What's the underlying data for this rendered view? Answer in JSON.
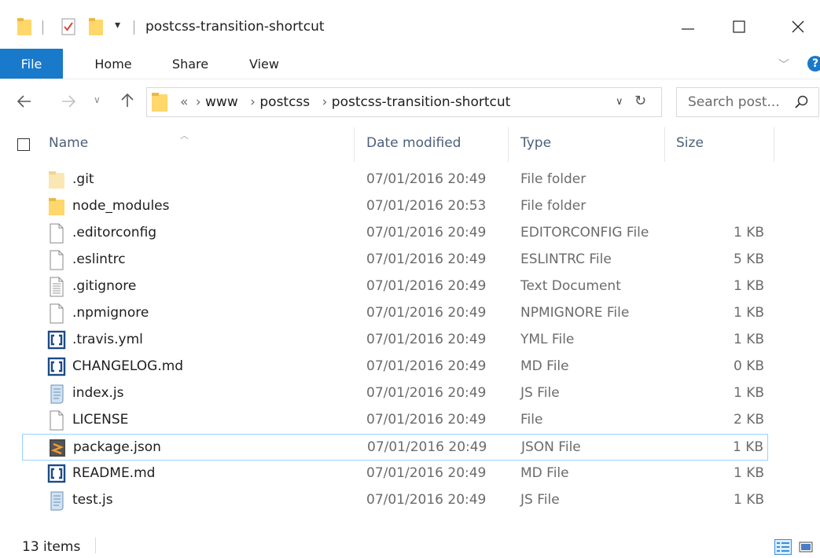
{
  "window": {
    "title": "postcss-transition-shortcut",
    "controls": {
      "minimize": "—",
      "maximize": "☐",
      "close": "✕"
    }
  },
  "ribbon": {
    "tabs": [
      {
        "label": "File",
        "active": true
      },
      {
        "label": "Home"
      },
      {
        "label": "Share"
      },
      {
        "label": "View"
      }
    ],
    "help": "?"
  },
  "nav": {
    "breadcrumbs": [
      "«",
      "www",
      "postcss",
      "postcss-transition-shortcut"
    ],
    "search_placeholder": "Search post..."
  },
  "columns": {
    "name": "Name",
    "date": "Date modified",
    "type": "Type",
    "size": "Size"
  },
  "files": [
    {
      "name": ".git",
      "date": "07/01/2016 20:49",
      "type": "File folder",
      "size": "",
      "icon": "folder-light-icon"
    },
    {
      "name": "node_modules",
      "date": "07/01/2016 20:53",
      "type": "File folder",
      "size": "",
      "icon": "folder-icon"
    },
    {
      "name": ".editorconfig",
      "date": "07/01/2016 20:49",
      "type": "EDITORCONFIG File",
      "size": "1 KB",
      "icon": "blank-file-icon"
    },
    {
      "name": ".eslintrc",
      "date": "07/01/2016 20:49",
      "type": "ESLINTRC File",
      "size": "5 KB",
      "icon": "blank-file-icon"
    },
    {
      "name": ".gitignore",
      "date": "07/01/2016 20:49",
      "type": "Text Document",
      "size": "1 KB",
      "icon": "text-file-icon"
    },
    {
      "name": ".npmignore",
      "date": "07/01/2016 20:49",
      "type": "NPMIGNORE File",
      "size": "1 KB",
      "icon": "blank-file-icon"
    },
    {
      "name": ".travis.yml",
      "date": "07/01/2016 20:49",
      "type": "YML File",
      "size": "1 KB",
      "icon": "brackets-file-icon"
    },
    {
      "name": "CHANGELOG.md",
      "date": "07/01/2016 20:49",
      "type": "MD File",
      "size": "0 KB",
      "icon": "brackets-file-icon"
    },
    {
      "name": "index.js",
      "date": "07/01/2016 20:49",
      "type": "JS File",
      "size": "1 KB",
      "icon": "script-file-icon"
    },
    {
      "name": "LICENSE",
      "date": "07/01/2016 20:49",
      "type": "File",
      "size": "2 KB",
      "icon": "blank-file-icon"
    },
    {
      "name": "package.json",
      "date": "07/01/2016 20:49",
      "type": "JSON File",
      "size": "1 KB",
      "icon": "sublime-file-icon",
      "selected": true
    },
    {
      "name": "README.md",
      "date": "07/01/2016 20:49",
      "type": "MD File",
      "size": "1 KB",
      "icon": "brackets-file-icon"
    },
    {
      "name": "test.js",
      "date": "07/01/2016 20:49",
      "type": "JS File",
      "size": "1 KB",
      "icon": "script-file-icon"
    }
  ],
  "status": {
    "item_count": "13 items"
  },
  "colors": {
    "file_tab": "#1979ca",
    "selection_border": "#99d1ff",
    "header_text": "#4c607a",
    "folder": "#ffd76a"
  }
}
